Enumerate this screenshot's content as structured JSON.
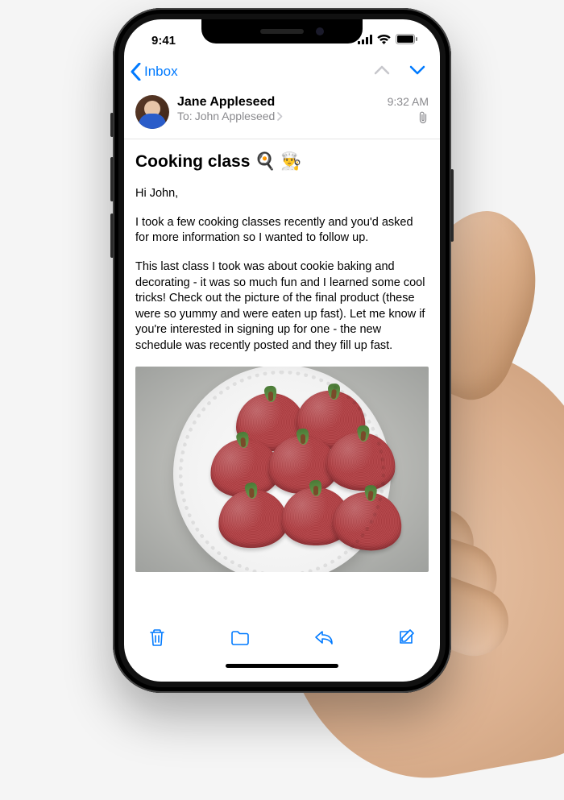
{
  "status": {
    "time": "9:41"
  },
  "nav": {
    "back_label": "Inbox"
  },
  "email": {
    "sender": "Jane Appleseed",
    "to_label": "To:",
    "recipient": "John Appleseed",
    "time": "9:32 AM",
    "subject": "Cooking class 🍳 👨‍🍳",
    "greeting": "Hi John,",
    "para1": "I took a few cooking classes recently and you'd asked for more information so I wanted to follow up.",
    "para2": "This last class I took was about cookie baking and decorating - it was so much fun and I learned some cool tricks! Check out the picture of the final product (these were so yummy and were eaten up fast). Let me know if you're interested in signing up for one - the new schedule was recently posted and they fill up fast."
  },
  "colors": {
    "accent": "#007aff"
  }
}
